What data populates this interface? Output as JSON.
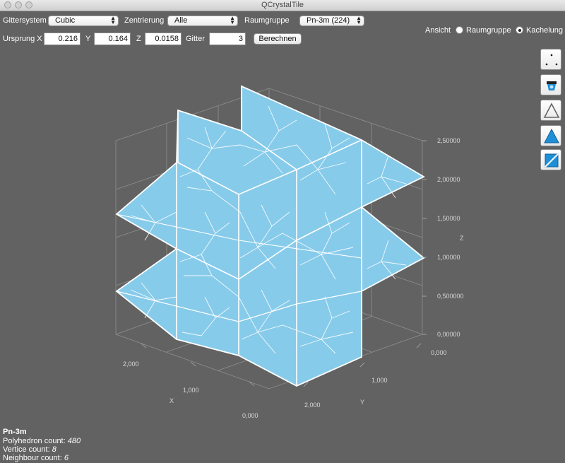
{
  "window": {
    "title": "QCrystalTile"
  },
  "toolbar": {
    "gittersystem_label": "Gittersystem",
    "gittersystem_value": "Cubic",
    "zentrierung_label": "Zentrierung",
    "zentrierung_value": "Alle",
    "raumgruppe_label": "Raumgruppe",
    "raumgruppe_value": "Pn-3m (224)",
    "ursprung_x_label": "Ursprung X",
    "ursprung_x_value": "0.216",
    "y_label": "Y",
    "y_value": "0.164",
    "z_label": "Z",
    "z_value": "0.0158",
    "gitter_label": "Gitter",
    "gitter_value": "3",
    "berechnen_label": "Berechnen",
    "ansicht_label": "Ansicht",
    "radio_raumgruppe_label": "Raumgruppe",
    "radio_kachelung_label": "Kachelung",
    "selected_view": "Kachelung"
  },
  "side_tools": [
    {
      "name": "points-icon"
    },
    {
      "name": "render-mode-icon"
    },
    {
      "name": "wireframe-triangle-icon"
    },
    {
      "name": "filled-triangle-icon"
    },
    {
      "name": "transparent-square-icon"
    }
  ],
  "plot": {
    "z_axis_label": "Z",
    "x_axis_label": "X",
    "y_axis_label": "Y",
    "z_ticks": [
      "2,50000",
      "2,00000",
      "1,50000",
      "1,00000",
      "0,500000",
      "0,00000"
    ],
    "x_ticks": [
      "2,000",
      "1,000",
      "0,000"
    ],
    "y_ticks": [
      "0,000",
      "1,000",
      "2,000"
    ],
    "face_color": "#87cbea",
    "edge_color": "#ffffff"
  },
  "info": {
    "group": "Pn-3m",
    "polyhedron_label": "Polyhedron count:",
    "polyhedron_value": "480",
    "vertice_label": "Vertice count:",
    "vertice_value": "8",
    "neighbour_label": "Neighbour count:",
    "neighbour_value": "6"
  }
}
